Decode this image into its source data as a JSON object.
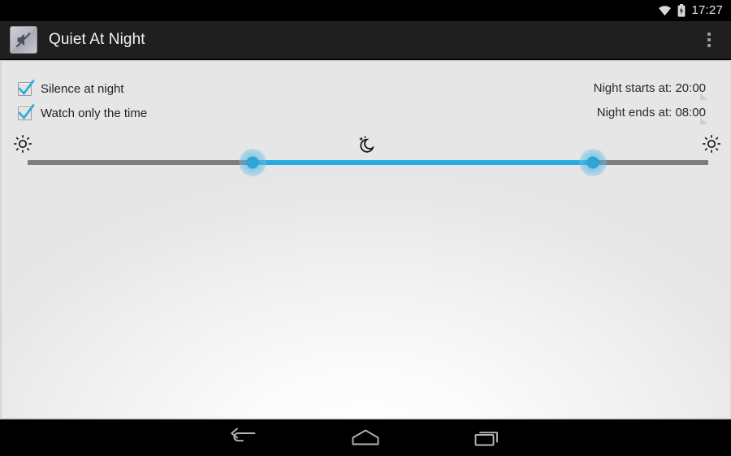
{
  "status_bar": {
    "wifi_icon": "wifi-icon",
    "battery_icon": "battery-charging-icon",
    "clock": "17:27"
  },
  "app_bar": {
    "app_icon": "mute-speaker-icon",
    "title": "Quiet At Night",
    "overflow_icon": "overflow-menu-icon"
  },
  "content": {
    "options": [
      {
        "label": "Silence at night",
        "checked": true
      },
      {
        "label": "Watch only the time",
        "checked": true
      }
    ],
    "times": [
      {
        "label": "Night starts at: 20:00"
      },
      {
        "label": "Night ends at: 08:00"
      }
    ],
    "slider": {
      "left_icon": "sun-icon",
      "middle_icon": "moon-stars-icon",
      "right_icon": "sun-icon",
      "start_thumb_percent": 33,
      "end_thumb_percent": 83,
      "track_color": "#7d7d7d",
      "fill_color": "#2aa8e0",
      "thumb_color": "#2aa8e0"
    }
  },
  "nav_bar": {
    "back_icon": "back-arrow-icon",
    "home_icon": "home-icon",
    "recents_icon": "recents-icon"
  }
}
